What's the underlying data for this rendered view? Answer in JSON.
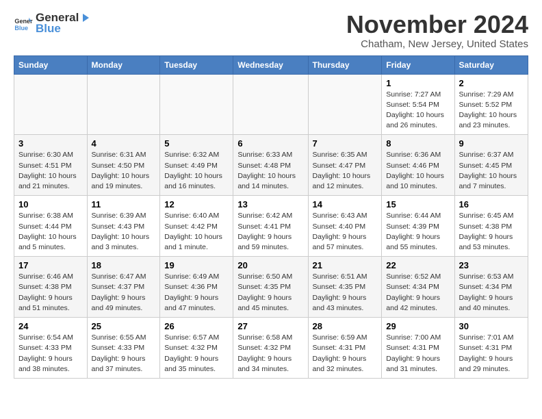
{
  "logo": {
    "general": "General",
    "blue": "Blue"
  },
  "title": "November 2024",
  "subtitle": "Chatham, New Jersey, United States",
  "days_of_week": [
    "Sunday",
    "Monday",
    "Tuesday",
    "Wednesday",
    "Thursday",
    "Friday",
    "Saturday"
  ],
  "weeks": [
    [
      {
        "day": "",
        "info": ""
      },
      {
        "day": "",
        "info": ""
      },
      {
        "day": "",
        "info": ""
      },
      {
        "day": "",
        "info": ""
      },
      {
        "day": "",
        "info": ""
      },
      {
        "day": "1",
        "info": "Sunrise: 7:27 AM\nSunset: 5:54 PM\nDaylight: 10 hours and 26 minutes."
      },
      {
        "day": "2",
        "info": "Sunrise: 7:29 AM\nSunset: 5:52 PM\nDaylight: 10 hours and 23 minutes."
      }
    ],
    [
      {
        "day": "3",
        "info": "Sunrise: 6:30 AM\nSunset: 4:51 PM\nDaylight: 10 hours and 21 minutes."
      },
      {
        "day": "4",
        "info": "Sunrise: 6:31 AM\nSunset: 4:50 PM\nDaylight: 10 hours and 19 minutes."
      },
      {
        "day": "5",
        "info": "Sunrise: 6:32 AM\nSunset: 4:49 PM\nDaylight: 10 hours and 16 minutes."
      },
      {
        "day": "6",
        "info": "Sunrise: 6:33 AM\nSunset: 4:48 PM\nDaylight: 10 hours and 14 minutes."
      },
      {
        "day": "7",
        "info": "Sunrise: 6:35 AM\nSunset: 4:47 PM\nDaylight: 10 hours and 12 minutes."
      },
      {
        "day": "8",
        "info": "Sunrise: 6:36 AM\nSunset: 4:46 PM\nDaylight: 10 hours and 10 minutes."
      },
      {
        "day": "9",
        "info": "Sunrise: 6:37 AM\nSunset: 4:45 PM\nDaylight: 10 hours and 7 minutes."
      }
    ],
    [
      {
        "day": "10",
        "info": "Sunrise: 6:38 AM\nSunset: 4:44 PM\nDaylight: 10 hours and 5 minutes."
      },
      {
        "day": "11",
        "info": "Sunrise: 6:39 AM\nSunset: 4:43 PM\nDaylight: 10 hours and 3 minutes."
      },
      {
        "day": "12",
        "info": "Sunrise: 6:40 AM\nSunset: 4:42 PM\nDaylight: 10 hours and 1 minute."
      },
      {
        "day": "13",
        "info": "Sunrise: 6:42 AM\nSunset: 4:41 PM\nDaylight: 9 hours and 59 minutes."
      },
      {
        "day": "14",
        "info": "Sunrise: 6:43 AM\nSunset: 4:40 PM\nDaylight: 9 hours and 57 minutes."
      },
      {
        "day": "15",
        "info": "Sunrise: 6:44 AM\nSunset: 4:39 PM\nDaylight: 9 hours and 55 minutes."
      },
      {
        "day": "16",
        "info": "Sunrise: 6:45 AM\nSunset: 4:38 PM\nDaylight: 9 hours and 53 minutes."
      }
    ],
    [
      {
        "day": "17",
        "info": "Sunrise: 6:46 AM\nSunset: 4:38 PM\nDaylight: 9 hours and 51 minutes."
      },
      {
        "day": "18",
        "info": "Sunrise: 6:47 AM\nSunset: 4:37 PM\nDaylight: 9 hours and 49 minutes."
      },
      {
        "day": "19",
        "info": "Sunrise: 6:49 AM\nSunset: 4:36 PM\nDaylight: 9 hours and 47 minutes."
      },
      {
        "day": "20",
        "info": "Sunrise: 6:50 AM\nSunset: 4:35 PM\nDaylight: 9 hours and 45 minutes."
      },
      {
        "day": "21",
        "info": "Sunrise: 6:51 AM\nSunset: 4:35 PM\nDaylight: 9 hours and 43 minutes."
      },
      {
        "day": "22",
        "info": "Sunrise: 6:52 AM\nSunset: 4:34 PM\nDaylight: 9 hours and 42 minutes."
      },
      {
        "day": "23",
        "info": "Sunrise: 6:53 AM\nSunset: 4:34 PM\nDaylight: 9 hours and 40 minutes."
      }
    ],
    [
      {
        "day": "24",
        "info": "Sunrise: 6:54 AM\nSunset: 4:33 PM\nDaylight: 9 hours and 38 minutes."
      },
      {
        "day": "25",
        "info": "Sunrise: 6:55 AM\nSunset: 4:33 PM\nDaylight: 9 hours and 37 minutes."
      },
      {
        "day": "26",
        "info": "Sunrise: 6:57 AM\nSunset: 4:32 PM\nDaylight: 9 hours and 35 minutes."
      },
      {
        "day": "27",
        "info": "Sunrise: 6:58 AM\nSunset: 4:32 PM\nDaylight: 9 hours and 34 minutes."
      },
      {
        "day": "28",
        "info": "Sunrise: 6:59 AM\nSunset: 4:31 PM\nDaylight: 9 hours and 32 minutes."
      },
      {
        "day": "29",
        "info": "Sunrise: 7:00 AM\nSunset: 4:31 PM\nDaylight: 9 hours and 31 minutes."
      },
      {
        "day": "30",
        "info": "Sunrise: 7:01 AM\nSunset: 4:31 PM\nDaylight: 9 hours and 29 minutes."
      }
    ]
  ]
}
